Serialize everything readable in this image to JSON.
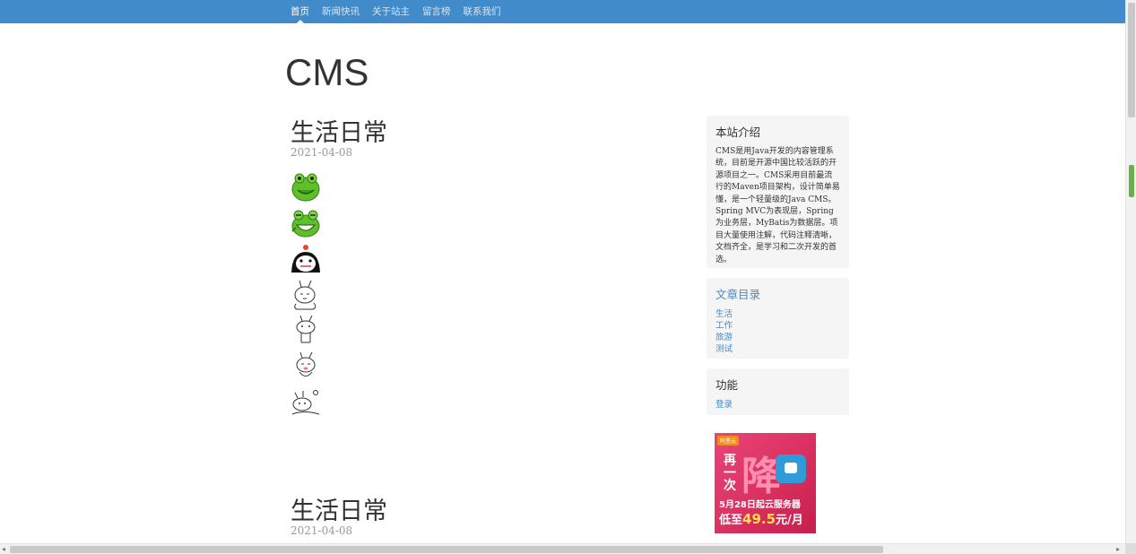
{
  "nav": {
    "items": [
      {
        "label": "首页",
        "active": true
      },
      {
        "label": "新闻快讯",
        "active": false
      },
      {
        "label": "关于站主",
        "active": false
      },
      {
        "label": "留言榜",
        "active": false
      },
      {
        "label": "联系我们",
        "active": false
      }
    ]
  },
  "site": {
    "title": "CMS"
  },
  "posts": [
    {
      "title": "生活日常",
      "date": "2021-04-08",
      "emojis": [
        "frog-smile-icon",
        "frog-grin-icon",
        "penguin-icon",
        "rabbit-sweat-icon",
        "rabbit-stand-icon",
        "rabbit-shy-icon",
        "rabbit-lying-icon"
      ]
    },
    {
      "title": "生活日常",
      "date": "2021-04-08"
    }
  ],
  "sidebar": {
    "intro": {
      "title": "本站介绍",
      "text": "CMS是用Java开发的内容管理系统，目前是开源中国比较活跃的开源项目之一。CMS采用目前最流行的Maven项目架构，设计简单易懂，是一个轻量级的Java CMS。Spring MVC为表现层，Spring为业务层，MyBatis为数据层。项目大量使用注解，代码注释清晰，文档齐全，是学习和二次开发的首选。"
    },
    "catalog": {
      "title": "文章目录",
      "items": [
        "生活",
        "工作",
        "旅游",
        "测试"
      ]
    },
    "features": {
      "title": "功能",
      "items": [
        "登录"
      ]
    }
  },
  "ad": {
    "brand": "阿里云",
    "zai": "再一次",
    "jiang": "降",
    "line1": "5月28日起云服务器",
    "line2_prefix": "低至",
    "line2_price": "49.5",
    "line2_suffix": "元/月"
  },
  "colors": {
    "nav_bg": "#428bca",
    "link": "#428bca",
    "sidebar_bg": "#f5f5f5"
  }
}
